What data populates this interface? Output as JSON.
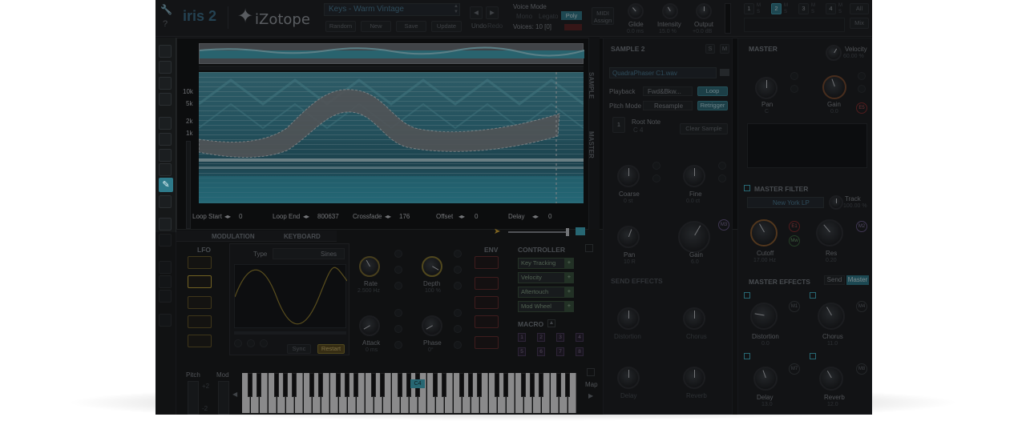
{
  "header": {
    "app_logo": "iris 2",
    "brand": "iZotope",
    "preset_name": "Keys - Warm Vintage",
    "preset_buttons": [
      "Random",
      "New",
      "Save",
      "Update"
    ],
    "undo_label": "Undo",
    "redo_label": "Redo",
    "voice_mode_title": "Voice Mode",
    "voice_modes": [
      "Mono",
      "Legato",
      "Poly"
    ],
    "voice_mode_selected": "Poly",
    "voices_label": "Voices: 10 [0]",
    "midi_assign": "MIDI Assign",
    "glide_label": "Glide",
    "glide_value": "0.0 ms",
    "intensity_label": "Intensity",
    "intensity_value": "15.0 %",
    "output_label": "Output",
    "output_value": "+0.0 dB",
    "sample_slots": [
      "1",
      "2",
      "3",
      "4"
    ],
    "slot_letters": [
      "M",
      "S",
      "M",
      "S",
      "M",
      "S",
      "M",
      "S"
    ],
    "active_slot": "2",
    "all_label": "All",
    "mix_label": "Mix"
  },
  "spectrogram": {
    "freq_labels": [
      "10k",
      "5k",
      "2k",
      "1k"
    ],
    "loop_start_label": "Loop Start",
    "loop_start_value": "0",
    "loop_end_label": "Loop End",
    "loop_end_value": "800637",
    "crossfade_label": "Crossfade",
    "crossfade_value": "176",
    "offset_label": "Offset",
    "offset_value": "0",
    "delay_label": "Delay",
    "delay_value": "0"
  },
  "sample_panel": {
    "title": "SAMPLE 2",
    "s_btn": "S",
    "m_btn": "M",
    "vert_tabs": [
      "SAMPLE",
      "MASTER"
    ],
    "file_name": "QuadraPhaser C1.wav",
    "playback_label": "Playback",
    "playback_value": "Fwd&Bkw...",
    "loop_btn": "Loop",
    "pitch_mode_label": "Pitch Mode",
    "pitch_mode_value": "Resample",
    "retrigger_btn": "Retrigger",
    "root_note_label": "Root Note",
    "root_note_value": "C 4",
    "clear_sample": "Clear Sample",
    "coarse_label": "Coarse",
    "coarse_value": "0 st",
    "fine_label": "Fine",
    "fine_value": "0.0 ct",
    "pan_label": "Pan",
    "pan_value": "10 R",
    "gain_label": "Gain",
    "gain_value": "6.0",
    "send_effects": "SEND EFFECTS",
    "distortion": "Distortion",
    "chorus": "Chorus",
    "delay": "Delay",
    "reverb": "Reverb",
    "m3": "M3"
  },
  "master": {
    "title": "MASTER",
    "velocity_label": "Velocity",
    "velocity_value": "60.00 %",
    "pan_label": "Pan",
    "pan_value": "C",
    "gain_label": "Gain",
    "gain_value": "0.0",
    "e5": "E5",
    "filter_title": "MASTER FILTER",
    "filter_type": "New York LP",
    "track_label": "Track",
    "track_value": "100.00 %",
    "cutoff_label": "Cutoff",
    "cutoff_value": "17.00 Hz",
    "res_label": "Res",
    "res_value": "0.20",
    "e1": "E1",
    "mw": "Mw",
    "m2": "M2",
    "effects_title": "MASTER EFFECTS",
    "send_tab": "Send",
    "master_tab": "Master",
    "distortion": "Distortion",
    "distortion_value": "0.0",
    "chorus": "Chorus",
    "chorus_value": "11.0",
    "delay": "Delay",
    "delay_value": "13.0",
    "reverb": "Reverb",
    "reverb_value": "12.0",
    "m1": "M1",
    "m4": "M4",
    "m7": "M7",
    "m8": "M8"
  },
  "modulation": {
    "tabs": [
      "MODULATION",
      "KEYBOARD"
    ],
    "lfo_title": "LFO",
    "type_label": "Type",
    "type_value": "Sines",
    "rate_label": "Rate",
    "rate_value": "2.500 Hz",
    "depth_label": "Depth",
    "depth_value": "100 %",
    "attack_label": "Attack",
    "attack_value": "0 ms",
    "phase_label": "Phase",
    "phase_value": "0°",
    "sync_btn": "Sync",
    "restart_btn": "Restart",
    "env_title": "ENV",
    "controller_title": "CONTROLLER",
    "controllers": [
      "Key Tracking",
      "Velocity",
      "Aftertouch",
      "Mod Wheel"
    ],
    "macro_title": "MACRO",
    "macros": [
      "1",
      "2",
      "3",
      "4",
      "5",
      "6",
      "7",
      "8"
    ]
  },
  "keyboard": {
    "pitch_label": "Pitch",
    "mod_label": "Mod",
    "pitch_vals": [
      "+2",
      "-2"
    ],
    "c4_label": "C4",
    "map_label": "Map"
  },
  "colors": {
    "accent_cyan": "#3fb3c6",
    "lfo_yellow": "#c7a934",
    "env_red": "#c0403a",
    "ctrl_green": "#6ea36e",
    "macro_purple": "#8a6fa8",
    "knob_orange": "#d98b3a"
  }
}
